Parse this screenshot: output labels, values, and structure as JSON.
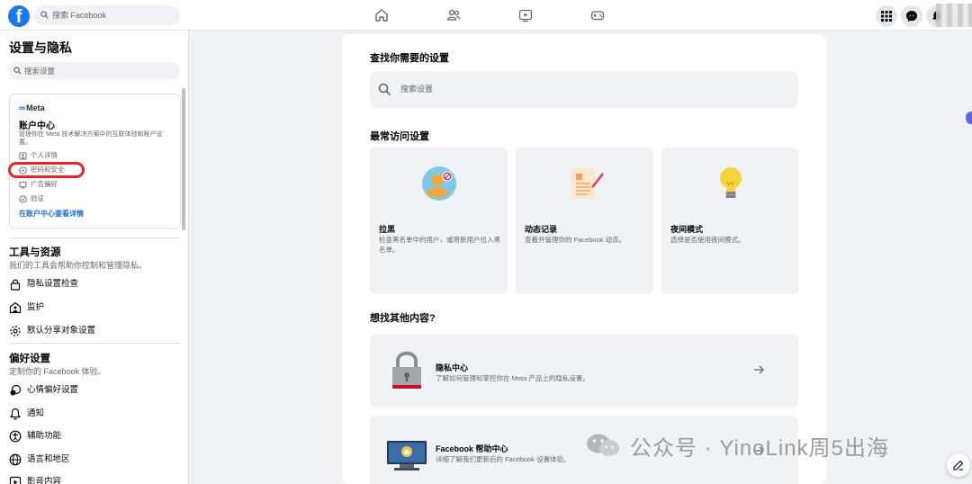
{
  "topbar": {
    "logo": "f",
    "search_placeholder": "搜索 Facebook",
    "nav_icons": [
      "home-icon",
      "friends-icon",
      "video-icon",
      "gaming-icon"
    ],
    "right_icons": [
      "grid-menu-icon",
      "messenger-icon",
      "bell-icon"
    ]
  },
  "sidebar": {
    "title": "设置与隐私",
    "search_placeholder": "搜索设置",
    "account_center": {
      "brand": "Meta",
      "title": "账户中心",
      "desc": "管理你在 Meta 技术解决方案中的互联体验和账户设置。",
      "items": [
        {
          "label": "个人详情",
          "icon": "person-card-icon"
        },
        {
          "label": "密码和安全",
          "icon": "shield-icon"
        },
        {
          "label": "广告偏好",
          "icon": "monitor-icon"
        },
        {
          "label": "验证",
          "icon": "check-circle-icon"
        }
      ],
      "link": "在账户中心查看详情"
    },
    "tools": {
      "title": "工具与资源",
      "desc": "我们的工具会帮助你控制和管理隐私。",
      "items": [
        {
          "label": "隐私设置检查",
          "icon": "lock-icon"
        },
        {
          "label": "监护",
          "icon": "supervision-icon"
        },
        {
          "label": "默认分享对象设置",
          "icon": "gear-icon"
        }
      ]
    },
    "preferences": {
      "title": "偏好设置",
      "desc": "定制你的 Facebook 体验。",
      "items": [
        {
          "label": "心情偏好设置",
          "icon": "reaction-icon"
        },
        {
          "label": "通知",
          "icon": "bell-icon"
        },
        {
          "label": "辅助功能",
          "icon": "accessibility-icon"
        },
        {
          "label": "语言和地区",
          "icon": "globe-icon"
        },
        {
          "label": "影音内容",
          "icon": "media-icon"
        }
      ]
    }
  },
  "main": {
    "find_title": "查找你需要的设置",
    "search_placeholder": "搜索设置",
    "frequent_title": "最常访问设置",
    "tiles": [
      {
        "title": "拉黑",
        "desc": "检查黑名单中的用户，或将新用户拉入黑名单。",
        "icon": "block-user-icon"
      },
      {
        "title": "动态记录",
        "desc": "查看并管理你的 Facebook 动态。",
        "icon": "activity-log-icon"
      },
      {
        "title": "夜间模式",
        "desc": "选择是否使用夜间模式。",
        "icon": "lightbulb-icon"
      }
    ],
    "more_title": "想找其他内容?",
    "more_items": [
      {
        "title": "隐私中心",
        "desc": "了解如何管理和掌控你在 Meta 产品上的隐私设置。",
        "icon": "padlock-icon"
      },
      {
        "title": "Facebook 帮助中心",
        "desc": "详细了解我们更新后的 Facebook 设置体验。",
        "icon": "help-monitor-icon"
      }
    ]
  },
  "watermark": "公众号 · YinoLink周5出海",
  "colors": {
    "brand": "#1877f2",
    "highlight": "#e8232b",
    "link": "#216fdb"
  }
}
